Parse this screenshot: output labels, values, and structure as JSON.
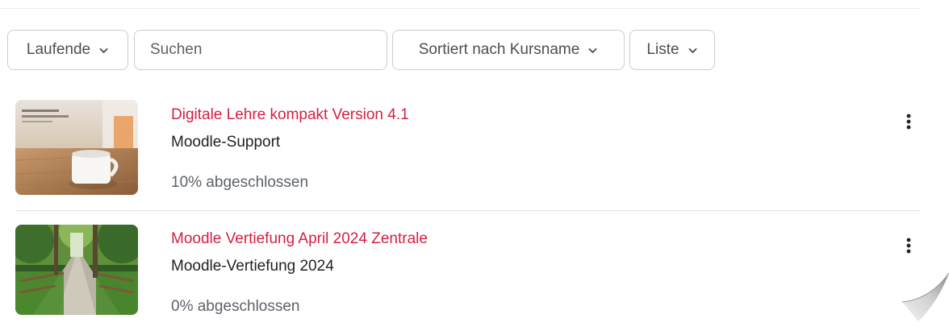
{
  "filters": {
    "grouping_label": "Laufende",
    "search_placeholder": "Suchen",
    "sort_label": "Sortiert nach Kursname",
    "view_label": "Liste"
  },
  "courses": [
    {
      "title": "Digitale Lehre kompakt Version 4.1",
      "category": "Moodle-Support",
      "progress_text": "10% abgeschlossen",
      "progress": 10,
      "thumbnail": "coffee-cup-on-wooden-table-image"
    },
    {
      "title": "Moodle Vertiefung April 2024 Zentrale",
      "category": "Moodle-Vertiefung 2024",
      "progress_text": "0% abgeschlossen",
      "progress": 0,
      "thumbnail": "forest-path-image"
    }
  ],
  "icons": {
    "dropdown": "chevron-down-icon",
    "course_menu": "three-dots-vertical-icon"
  },
  "colors": {
    "course_title": "#d61f41",
    "text": "#1d2125",
    "muted_text": "#5d6268",
    "border": "#c9cdd2"
  }
}
